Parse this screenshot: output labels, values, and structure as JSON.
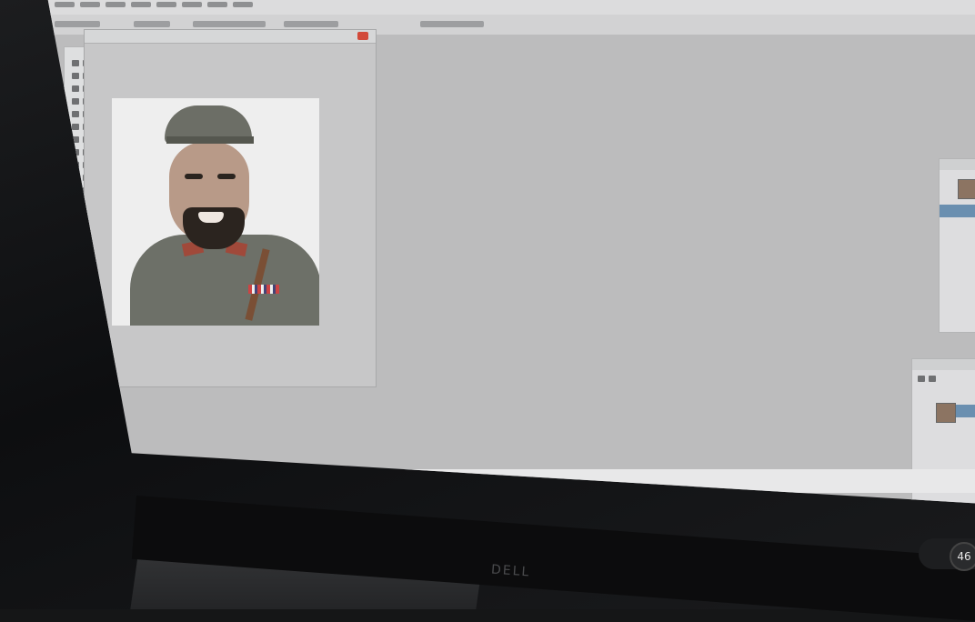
{
  "monitor": {
    "brand": "DELL"
  },
  "photoshop": {
    "document": {
      "title": "",
      "zoom": ""
    },
    "status": {
      "text": ""
    },
    "taskbar": {
      "items": [
        "",
        "",
        ""
      ]
    }
  },
  "overlay": {
    "net_up": "",
    "net_down": "",
    "badge_value": "46"
  },
  "colors": {
    "screen_bg": "#bcbcbd",
    "close_button": "#d24a3a",
    "foreground_swatch": "#111111",
    "background_swatch": "#f4f4f4"
  },
  "icons": {
    "close": "close-icon",
    "toolbox": "toolbox-icons",
    "layer_thumbnail": "layer-thumbnail-icon"
  }
}
